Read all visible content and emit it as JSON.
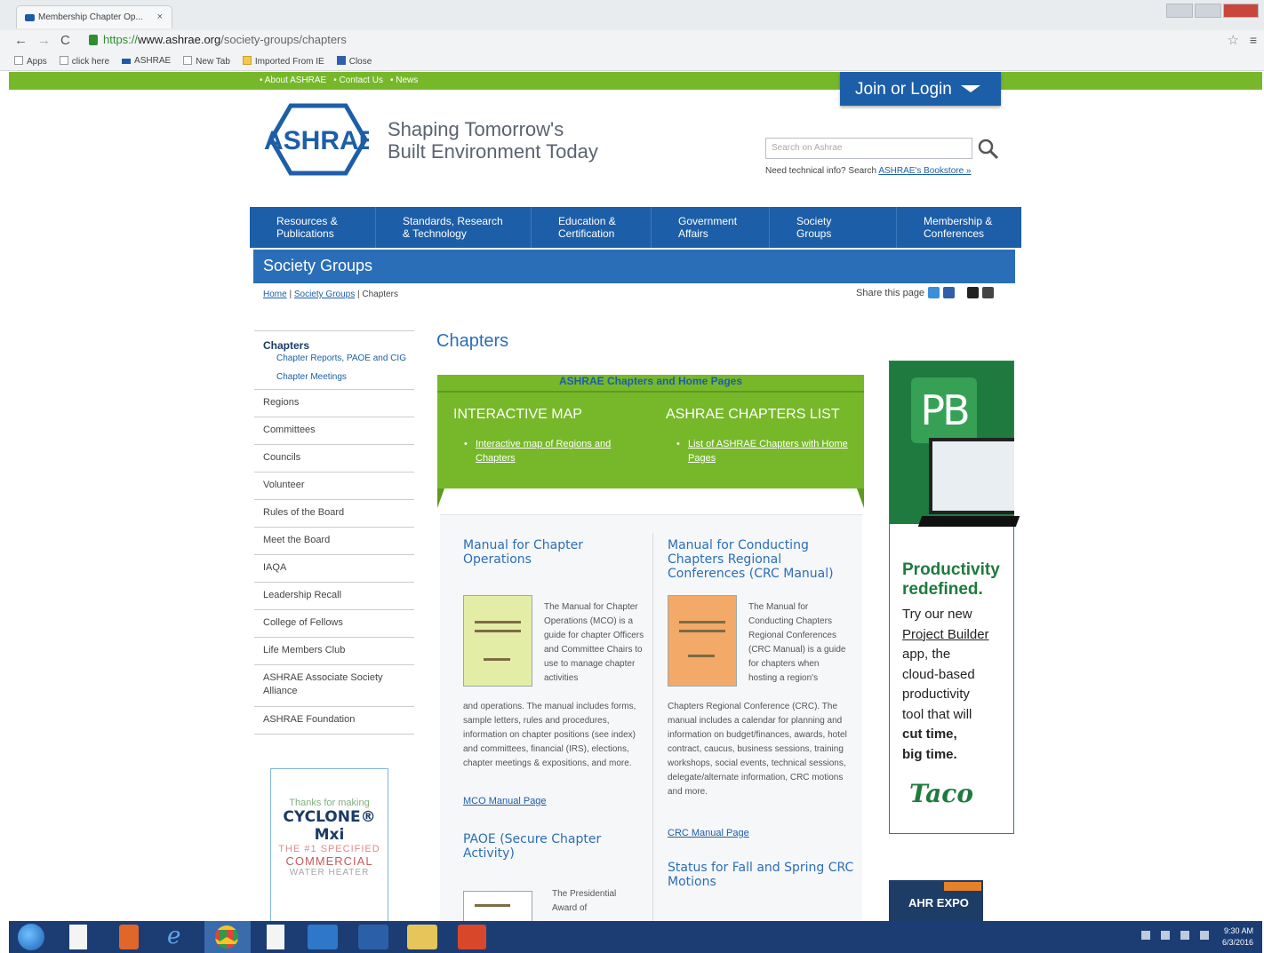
{
  "browser": {
    "tab_title": "Membership Chapter Op...",
    "url_scheme": "https://",
    "url_host": "www.ashrae.org",
    "url_path": "/society-groups/chapters",
    "bookmarks": [
      "Apps",
      "click here",
      "ASHRAE",
      "New Tab",
      "Imported From IE",
      "Close"
    ]
  },
  "header": {
    "top_links": [
      "• About ASHRAE",
      "• Contact Us",
      "• News"
    ],
    "join_label": "Join or Login",
    "logo_text": "ASHRAE",
    "tagline_1": "Shaping Tomorrow's",
    "tagline_2": "Built Environment Today",
    "search_placeholder": "Search on Ashrae",
    "tech_info_prefix": "Need technical info? Search ",
    "tech_info_link": "ASHRAE's Bookstore »"
  },
  "nav": [
    "Resources &\nPublications",
    "Standards, Research\n& Technology",
    "Education &\nCertification",
    "Government\nAffairs",
    "Society\nGroups",
    "Membership &\nConferences"
  ],
  "section_title": "Society Groups",
  "breadcrumb": {
    "home": "Home",
    "sep": " | ",
    "society": "Society Groups",
    "current": "Chapters"
  },
  "share_label": "Share this page",
  "sidebar": {
    "head": "Chapters",
    "subs": [
      "Chapter Reports, PAOE and CIG",
      "Chapter Meetings"
    ],
    "items": [
      "Regions",
      "Committees",
      "Councils",
      "Volunteer",
      "Rules of the Board",
      "Meet the Board",
      "IAQA",
      "Leadership Recall",
      "College of Fellows",
      "Life Members Club",
      "ASHRAE Associate Society Alliance",
      "ASHRAE Foundation"
    ]
  },
  "cyclone_ad": {
    "a": "Thanks for making",
    "b": "CYCLONE® Mxi",
    "c": "THE #1 SPECIFIED",
    "d": "COMMERCIAL",
    "e": "WATER HEATER"
  },
  "content": {
    "title": "Chapters",
    "box_header": "ASHRAE Chapters and Home Pages",
    "map_title": "INTERACTIVE MAP",
    "map_link": "Interactive map of Regions and Chapters",
    "list_title": "ASHRAE CHAPTERS LIST",
    "list_link": "List of ASHRAE Chapters with Home Pages"
  },
  "articles": {
    "mco": {
      "title": "Manual for Chapter Operations",
      "desc_top": "The Manual for Chapter Operations (MCO) is a guide for chapter Officers and Committee Chairs to use to manage chapter activities",
      "desc_bottom": "and operations. The manual includes forms, sample letters, rules and procedures, information on chapter positions (see index) and committees, financial (IRS), elections, chapter meetings & expositions, and more.",
      "link": "MCO Manual Page"
    },
    "crc": {
      "title": "Manual for Conducting Chapters Regional Conferences (CRC Manual)",
      "desc_top": "The Manual for Conducting Chapters Regional Conferences (CRC Manual) is a guide for chapters when hosting a region's",
      "desc_bottom": "Chapters Regional Conference (CRC). The manual includes a calendar for planning and information on budget/finances, awards, hotel contract, caucus, business sessions, training workshops, social events, technical sessions, delegate/alternate information, CRC motions and more.",
      "link": "CRC Manual Page"
    },
    "paoe": {
      "title": "PAOE (Secure Chapter Activity)",
      "desc": "The Presidential Award of"
    },
    "status": {
      "title": "Status for Fall and Spring CRC Motions"
    }
  },
  "pb_ad": {
    "logo": "PB",
    "headline_1": "Productivity",
    "headline_2": "redefined.",
    "line1": "Try our new",
    "line2": "Project Builder",
    "line3": "app, the",
    "line4": "cloud-based",
    "line5": "productivity",
    "line6": "tool that will",
    "line7": "cut time,",
    "line8": "big time.",
    "brand": "Taco"
  },
  "ahr_ad": {
    "text": "AHR EXPO"
  },
  "taskbar": {
    "time": "9:30 AM",
    "date": "6/3/2016"
  }
}
